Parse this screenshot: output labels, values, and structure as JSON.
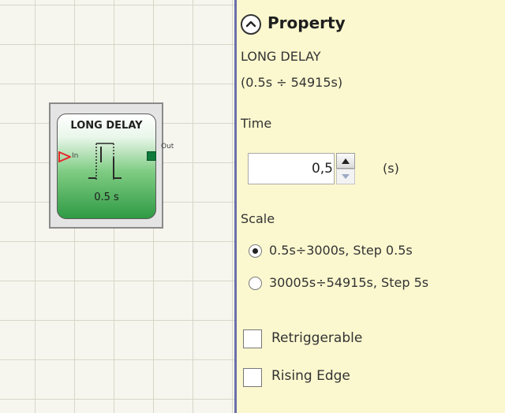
{
  "canvas": {
    "block": {
      "title": "LONG DELAY",
      "input_label": "In",
      "output_label": "Out",
      "value": "0.5 s"
    }
  },
  "panel": {
    "title": "Property",
    "block_name": "LONG DELAY",
    "block_range": "(0.5s ÷ 54915s)",
    "time": {
      "label": "Time",
      "value": "0,5",
      "unit": "(s)"
    },
    "scale": {
      "label": "Scale",
      "options": [
        {
          "label": "0.5s÷3000s, Step 0.5s",
          "selected": true
        },
        {
          "label": "30005s÷54915s, Step 5s",
          "selected": false
        }
      ]
    },
    "checkboxes": [
      {
        "label": "Retriggerable",
        "checked": false
      },
      {
        "label": "Rising Edge",
        "checked": false
      }
    ]
  },
  "colors": {
    "panel_background": "#fbf8cf",
    "block_green": "#2f9a44",
    "input_arrow": "#e8262b",
    "output_port": "#0d7a3b"
  }
}
